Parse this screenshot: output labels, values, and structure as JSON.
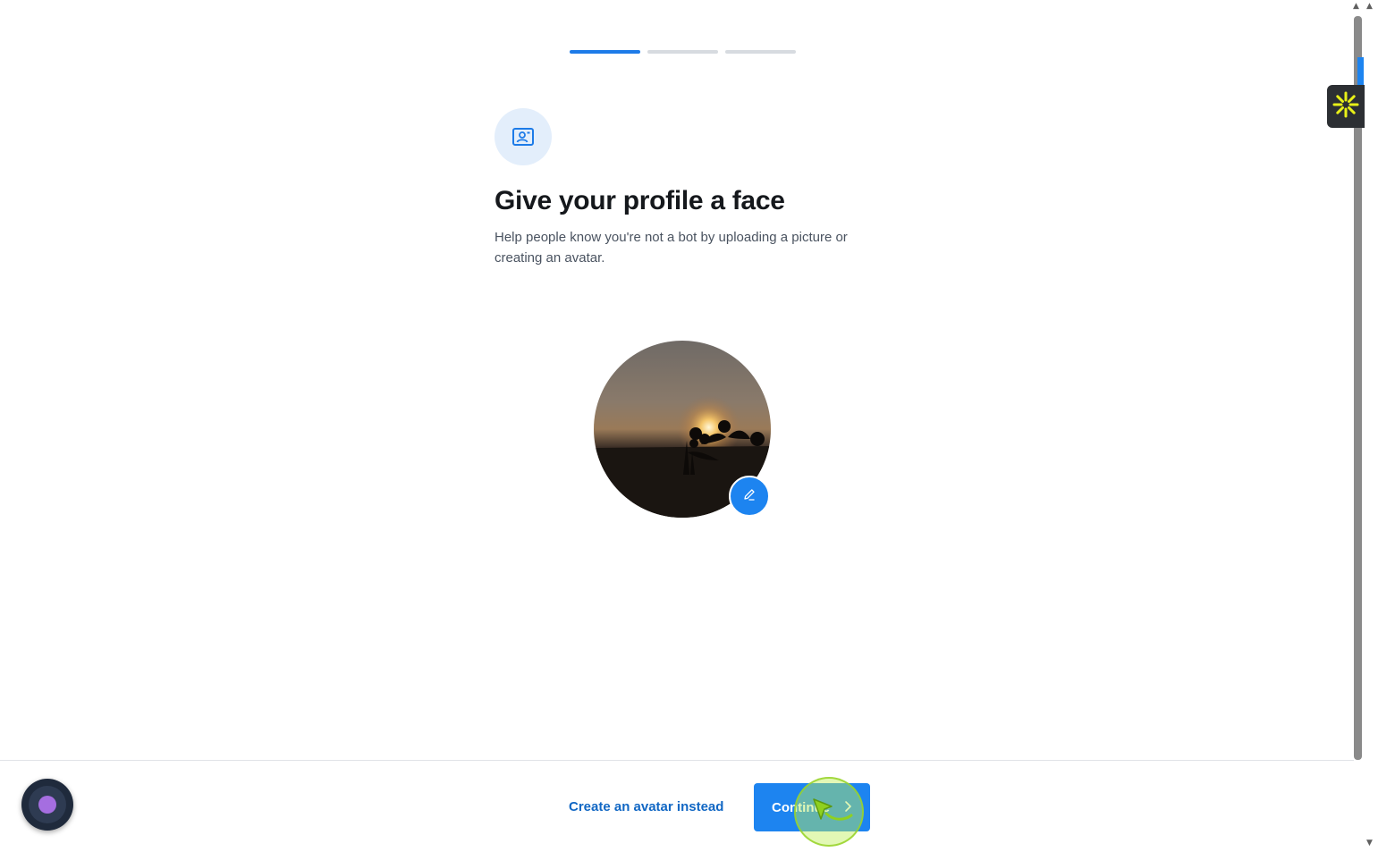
{
  "progress": {
    "total_steps": 3,
    "current_step": 1
  },
  "header": {
    "icon": "profile-card-icon",
    "title": "Give your profile a face",
    "subtitle": "Help people know you're not a bot by uploading a picture or creating an avatar."
  },
  "avatar": {
    "image": "sunset-silhouette-photo",
    "edit_icon": "pencil-icon"
  },
  "footer": {
    "secondary_label": "Create an avatar instead",
    "primary_label": "Continue",
    "primary_icon": "chevron-right-icon"
  },
  "colors": {
    "accent": "#1d84f0",
    "link": "#1167c4",
    "step_active": "#1d7be8",
    "step_inactive": "#d7dbe0",
    "icon_bg": "#e3eefb",
    "widget_accent": "#e8f018"
  }
}
